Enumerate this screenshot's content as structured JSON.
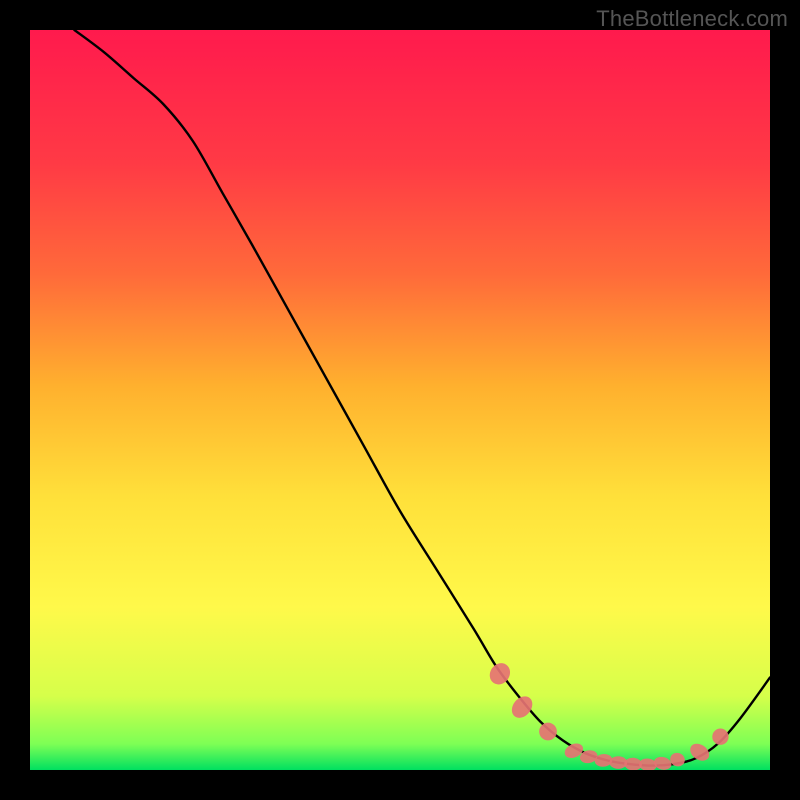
{
  "watermark": "TheBottleneck.com",
  "chart_data": {
    "type": "line",
    "title": "",
    "xlabel": "",
    "ylabel": "",
    "xlim": [
      0,
      100
    ],
    "ylim": [
      0,
      100
    ],
    "grid": false,
    "background_gradient": {
      "top_color": "#ff1a4d",
      "mid_colors": [
        "#ff6a3a",
        "#ffb02e",
        "#ffe03a",
        "#fff94a",
        "#d6ff4a"
      ],
      "bottom_color": "#00e060"
    },
    "series": [
      {
        "name": "bottleneck-curve",
        "color": "#000000",
        "x": [
          6,
          10,
          14,
          18,
          22,
          26,
          30,
          35,
          40,
          45,
          50,
          55,
          60,
          63,
          66,
          69,
          72,
          75,
          78,
          81,
          84,
          87,
          90,
          93,
          96,
          100
        ],
        "y": [
          100,
          97,
          93.5,
          90,
          85,
          78,
          71,
          62,
          53,
          44,
          35,
          27,
          19,
          14,
          10,
          6.5,
          4,
          2.3,
          1.3,
          0.8,
          0.6,
          0.8,
          1.6,
          3.6,
          7,
          12.5
        ]
      }
    ],
    "markers": {
      "name": "highlighted-points",
      "color": "#e57373",
      "points": [
        {
          "x": 63.5,
          "y": 13.0,
          "rx": 1.5,
          "ry": 1.3,
          "rot": -55
        },
        {
          "x": 66.5,
          "y": 8.5,
          "rx": 1.6,
          "ry": 1.2,
          "rot": -50
        },
        {
          "x": 70.0,
          "y": 5.2,
          "rx": 1.2,
          "ry": 1.2,
          "rot": 0
        },
        {
          "x": 73.5,
          "y": 2.6,
          "rx": 1.3,
          "ry": 0.9,
          "rot": -25
        },
        {
          "x": 75.5,
          "y": 1.8,
          "rx": 1.2,
          "ry": 0.85,
          "rot": -12
        },
        {
          "x": 77.5,
          "y": 1.3,
          "rx": 1.2,
          "ry": 0.85,
          "rot": -6
        },
        {
          "x": 79.5,
          "y": 1.0,
          "rx": 1.2,
          "ry": 0.85,
          "rot": 0
        },
        {
          "x": 81.5,
          "y": 0.8,
          "rx": 1.2,
          "ry": 0.85,
          "rot": 4
        },
        {
          "x": 83.5,
          "y": 0.7,
          "rx": 1.2,
          "ry": 0.85,
          "rot": 8
        },
        {
          "x": 85.5,
          "y": 0.9,
          "rx": 1.2,
          "ry": 0.85,
          "rot": 14
        },
        {
          "x": 87.5,
          "y": 1.4,
          "rx": 1.0,
          "ry": 0.9,
          "rot": 20
        },
        {
          "x": 90.5,
          "y": 2.4,
          "rx": 1.4,
          "ry": 1.0,
          "rot": 35
        },
        {
          "x": 93.3,
          "y": 4.5,
          "rx": 1.1,
          "ry": 1.1,
          "rot": 0
        }
      ]
    }
  }
}
